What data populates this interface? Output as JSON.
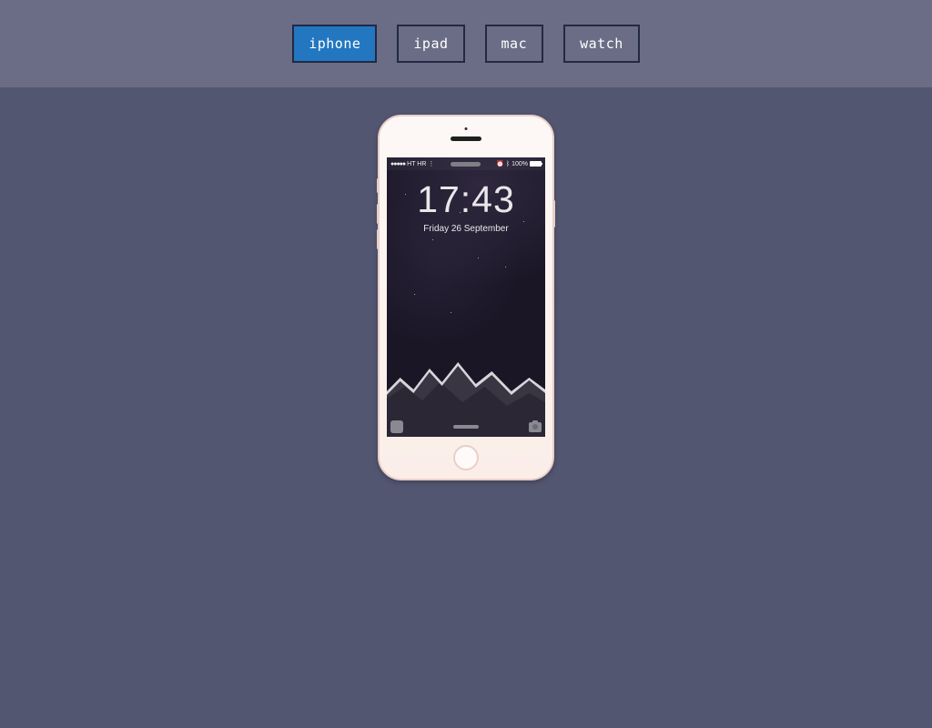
{
  "tabs": [
    {
      "id": "iphone",
      "label": "iphone",
      "active": true
    },
    {
      "id": "ipad",
      "label": "ipad",
      "active": false
    },
    {
      "id": "mac",
      "label": "mac",
      "active": false
    },
    {
      "id": "watch",
      "label": "watch",
      "active": false
    }
  ],
  "phone": {
    "status": {
      "carrier": "HT HR",
      "battery_text": "100%"
    },
    "lockscreen": {
      "time": "17:43",
      "date": "Friday 26 September"
    }
  }
}
